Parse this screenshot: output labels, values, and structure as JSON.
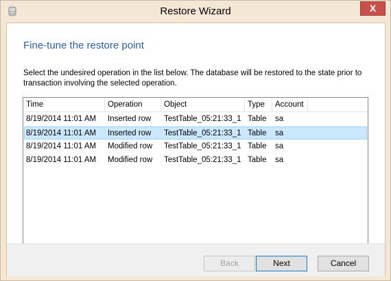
{
  "window": {
    "title": "Restore Wizard",
    "close_glyph": "X"
  },
  "page": {
    "heading": "Fine-tune the restore point",
    "description": "Select the undesired operation in the list below. The database will be restored to the state prior to transaction involving the selected operation."
  },
  "table": {
    "columns": [
      "Time",
      "Operation",
      "Object",
      "Type",
      "Account"
    ],
    "rows": [
      [
        "8/19/2014 11:01 AM",
        "Inserted row",
        "TestTable_05:21:33_1",
        "Table",
        "sa"
      ],
      [
        "8/19/2014 11:01 AM",
        "Inserted row",
        "TestTable_05:21:33_1",
        "Table",
        "sa"
      ],
      [
        "8/19/2014 11:01 AM",
        "Modified row",
        "TestTable_05:21:33_1",
        "Table",
        "sa"
      ],
      [
        "8/19/2014 11:01 AM",
        "Modified row",
        "TestTable_05:21:33_1",
        "Table",
        "sa"
      ]
    ],
    "selected_row": 1
  },
  "buttons": {
    "back": "Back",
    "next": "Next",
    "cancel": "Cancel"
  },
  "colors": {
    "frame": "#f5e7d5",
    "heading": "#2b5fa8",
    "selection": "#cce8ff",
    "close_button": "#c7504a"
  },
  "icons": {
    "app": "database-restore-icon",
    "close": "close-icon"
  }
}
